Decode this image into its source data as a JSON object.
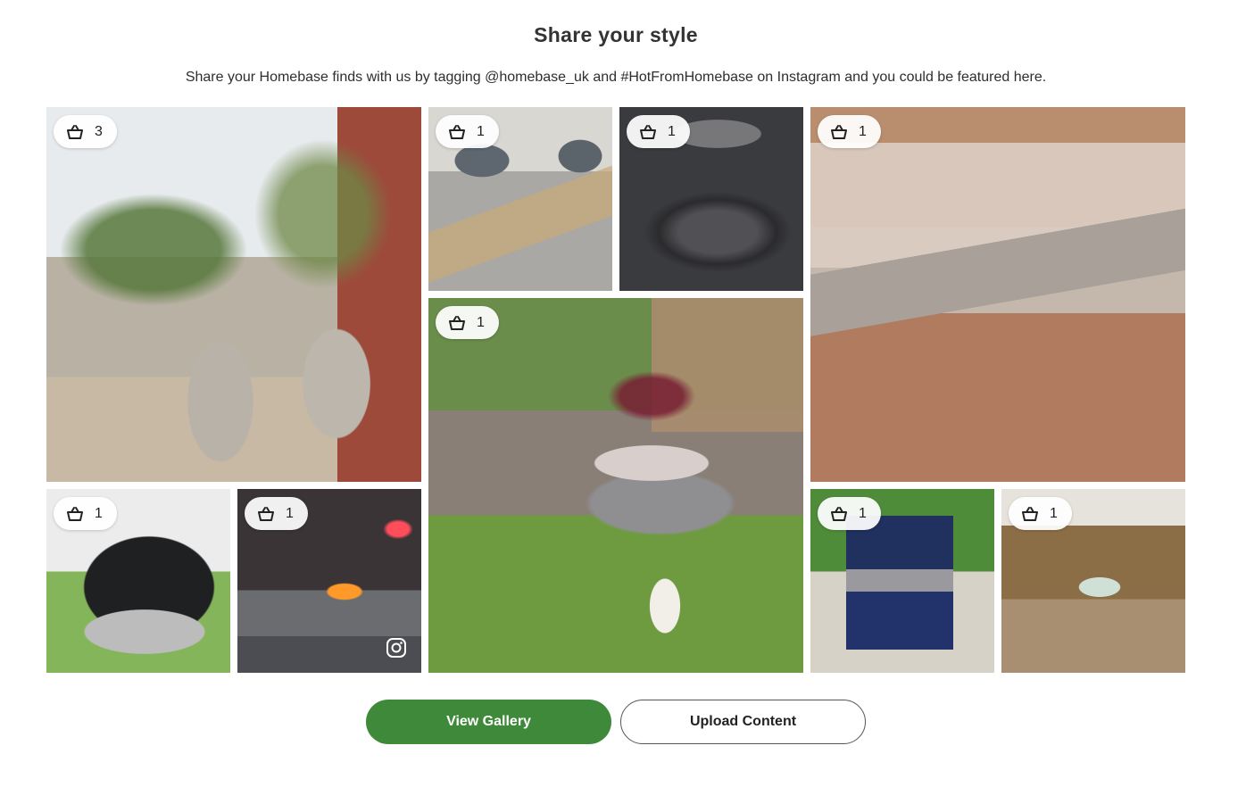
{
  "header": {
    "title": "Share your style",
    "subtitle": "Share your Homebase finds with us by tagging @homebase_uk and #HotFromHomebase on Instagram and you could be featured here."
  },
  "gallery": {
    "tiles": [
      {
        "id": "planters",
        "count": "3",
        "icon": "basket-icon"
      },
      {
        "id": "rattan-chairs",
        "count": "1",
        "icon": "basket-icon"
      },
      {
        "id": "metal-bistro-set",
        "count": "1",
        "icon": "basket-icon"
      },
      {
        "id": "corner-sofa-dining",
        "count": "1",
        "icon": "basket-icon"
      },
      {
        "id": "hot-tub",
        "count": "1",
        "icon": "basket-icon"
      },
      {
        "id": "fire-pit-patio",
        "count": "1",
        "icon": "basket-icon",
        "overlay_icon": "instagram-icon"
      },
      {
        "id": "garden-sofa-dog",
        "count": "1",
        "icon": "basket-icon"
      },
      {
        "id": "gas-bbq",
        "count": "1",
        "icon": "basket-icon"
      },
      {
        "id": "pergola-hot-tub",
        "count": "1",
        "icon": "basket-icon"
      }
    ]
  },
  "actions": {
    "view_gallery": "View Gallery",
    "upload_content": "Upload Content"
  },
  "colors": {
    "primary_button": "#3e8a3a",
    "text": "#2b2b2b"
  }
}
